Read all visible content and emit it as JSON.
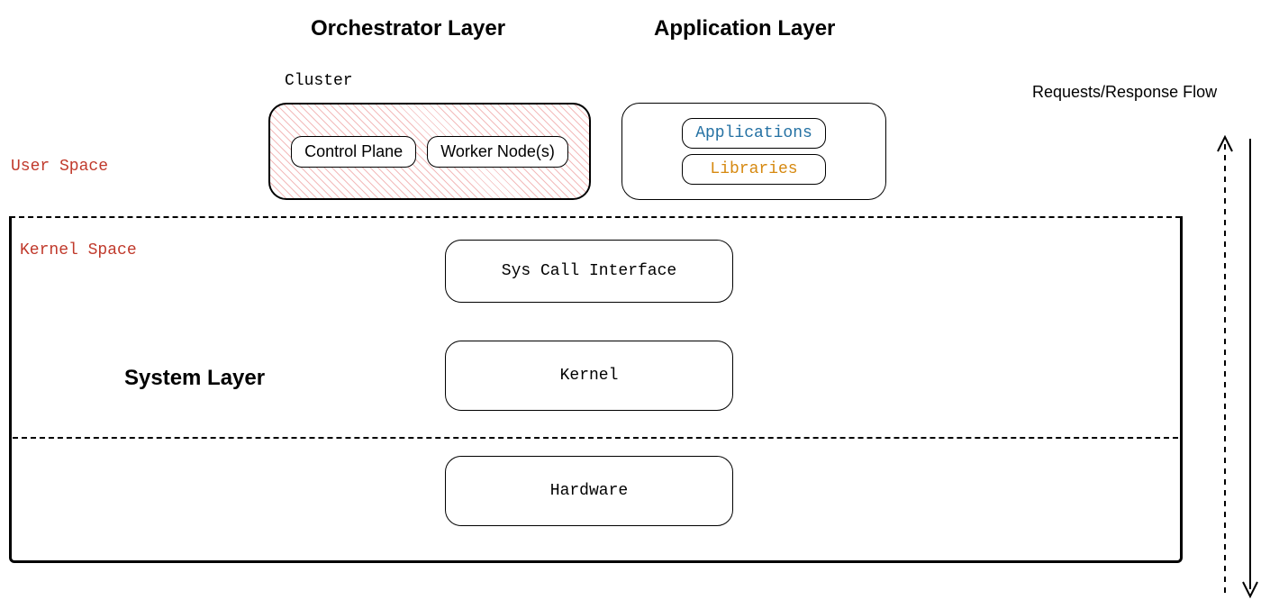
{
  "headings": {
    "orchestrator": "Orchestrator Layer",
    "application": "Application Layer"
  },
  "labels": {
    "cluster": "Cluster",
    "user_space": "User Space",
    "kernel_space": "Kernel Space",
    "flow": "Requests/Response Flow",
    "system_layer": "System Layer"
  },
  "cluster": {
    "control_plane": "Control Plane",
    "worker_nodes": "Worker Node(s)"
  },
  "app_layer": {
    "applications": "Applications",
    "libraries": "Libraries"
  },
  "system": {
    "syscall": "Sys Call Interface",
    "kernel": "Kernel",
    "hardware": "Hardware"
  },
  "colors": {
    "space_label": "#c0392b",
    "applications": "#2471a3",
    "libraries": "#d68910"
  }
}
